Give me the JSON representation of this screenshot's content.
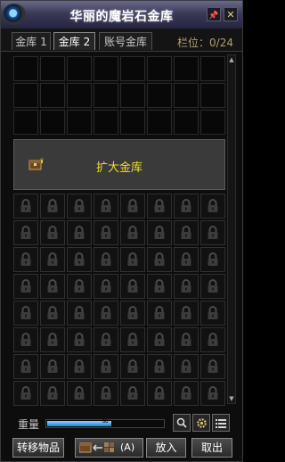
{
  "window": {
    "title": "华丽的魔岩石金库",
    "pin_glyph": "📌",
    "close_glyph": "✕"
  },
  "tabs": [
    {
      "label": "金库 1",
      "active": false
    },
    {
      "label": "金库 2",
      "active": true
    },
    {
      "label": "账号金库",
      "active": false
    }
  ],
  "slot_counter": "栏位：0/24",
  "storage": {
    "unlocked_rows": 3,
    "locked_rows": 8,
    "columns": 8
  },
  "expand": {
    "label": "扩大金库",
    "icon": "chest-icon"
  },
  "bottom": {
    "weight_label": "重量",
    "weight_value": "∞",
    "weight_fraction": 0.55,
    "search_icon": "search-icon",
    "settings_icon": "gear-icon",
    "list_icon": "list-icon",
    "transfer_label": "转移物品",
    "sort_label": "(A)",
    "put_label": "放入",
    "take_label": "取出"
  },
  "colors": {
    "counter": "#b3a069",
    "expand_text": "#f0e020",
    "weight_fill": "#5ab8ee"
  }
}
